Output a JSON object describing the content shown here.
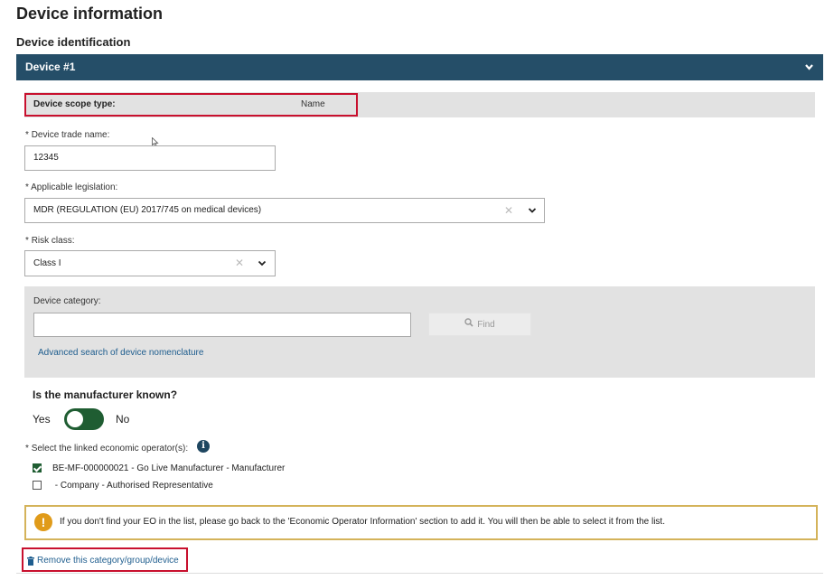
{
  "page": {
    "title": "Device information",
    "section_title": "Device identification"
  },
  "device": {
    "header": "Device #1",
    "scope_label": "Device scope type:",
    "scope_value": "Name",
    "trade_name_label": "Device trade name:",
    "trade_name_value": "12345",
    "legislation_label": "Applicable legislation:",
    "legislation_value": "MDR (REGULATION (EU) 2017/745 on medical devices)",
    "risk_label": "Risk class:",
    "risk_value": "Class I",
    "required_mark": "*"
  },
  "category": {
    "label": "Device category:",
    "input_value": "",
    "find_label": "Find",
    "advanced_link": "Advanced search of device nomenclature"
  },
  "manufacturer": {
    "question": "Is the manufacturer known?",
    "yes_label": "Yes",
    "no_label": "No"
  },
  "operators": {
    "label": "Select the linked economic operator(s):",
    "items": [
      {
        "text": "BE-MF-000000021 - Go Live Manufacturer - Manufacturer",
        "checked": true
      },
      {
        "text": " - Company - Authorised Representative",
        "checked": false
      }
    ]
  },
  "warning": {
    "text": "If you don't find your EO in the list, please go back to the 'Economic Operator Information' section to add it. You will then be able to select it from the list."
  },
  "actions": {
    "remove_label": "Remove this category/group/device"
  },
  "colors": {
    "header_bar": "#254e68",
    "toggle_on": "#1f5d32",
    "highlight": "#c8102e",
    "warning_border": "#d4b35a",
    "warning_icon": "#e09b1a",
    "link": "#1e5d8e"
  },
  "icons": {
    "collapse": "chevron-down-icon",
    "clear": "clear-icon",
    "dropdown": "caret-down-icon",
    "search": "search-icon",
    "info": "info-icon",
    "warning": "warning-icon",
    "remove": "trash-icon"
  }
}
